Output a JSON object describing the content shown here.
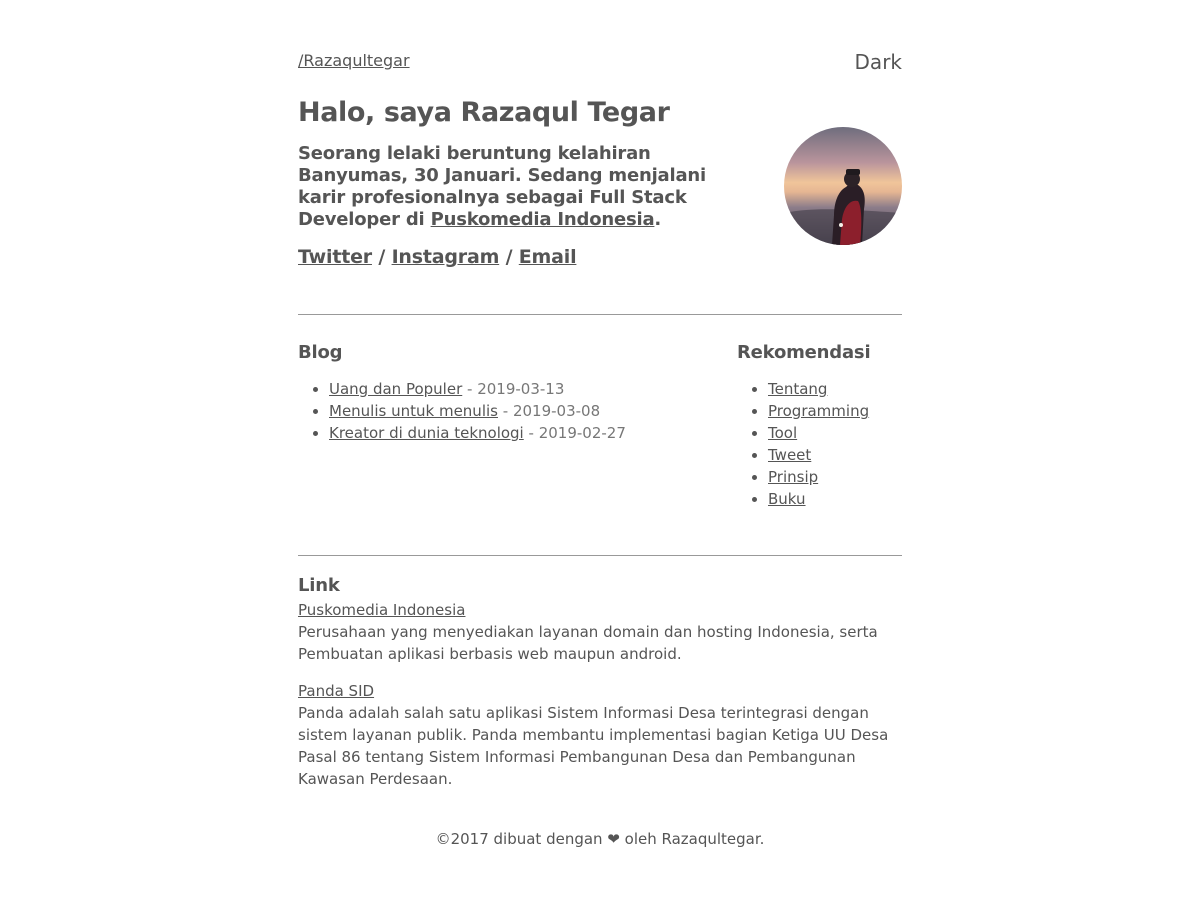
{
  "header": {
    "site_link": "/Razaqultegar",
    "theme_toggle": "Dark"
  },
  "hero": {
    "title": "Halo, saya Razaqul Tegar",
    "bio_prefix": "Seorang lelaki beruntung kelahiran Banyumas, 30 Januari. Sedang menjalani karir profesionalnya sebagai Full Stack Developer di ",
    "bio_company": "Puskomedia Indonesia",
    "bio_suffix": ".",
    "socials": [
      "Twitter",
      "Instagram",
      "Email"
    ],
    "separator": "/"
  },
  "blog": {
    "title": "Blog",
    "posts": [
      {
        "title": "Uang dan Populer",
        "date": "2019-03-13"
      },
      {
        "title": "Menulis untuk menulis",
        "date": "2019-03-08"
      },
      {
        "title": "Kreator di dunia teknologi",
        "date": "2019-02-27"
      }
    ]
  },
  "recommendations": {
    "title": "Rekomendasi",
    "items": [
      "Tentang",
      "Programming",
      "Tool",
      "Tweet",
      "Prinsip",
      "Buku"
    ]
  },
  "links": {
    "title": "Link",
    "items": [
      {
        "name": "Puskomedia Indonesia",
        "description": "Perusahaan yang menyediakan layanan domain dan hosting Indonesia, serta Pembuatan aplikasi berbasis web maupun android."
      },
      {
        "name": "Panda SID",
        "description": "Panda adalah salah satu aplikasi Sistem Informasi Desa terintegrasi dengan sistem layanan publik. Panda membantu implementasi bagian Ketiga UU Desa Pasal 86 tentang Sistem Informasi Pembangunan Desa dan Pembangunan Kawasan Perdesaan."
      }
    ]
  },
  "footer": {
    "text": "©2017 dibuat dengan ❤ oleh Razaqultegar."
  },
  "colors": {
    "text": "#555555",
    "muted": "#777777",
    "divider": "#999999",
    "background": "#ffffff"
  }
}
